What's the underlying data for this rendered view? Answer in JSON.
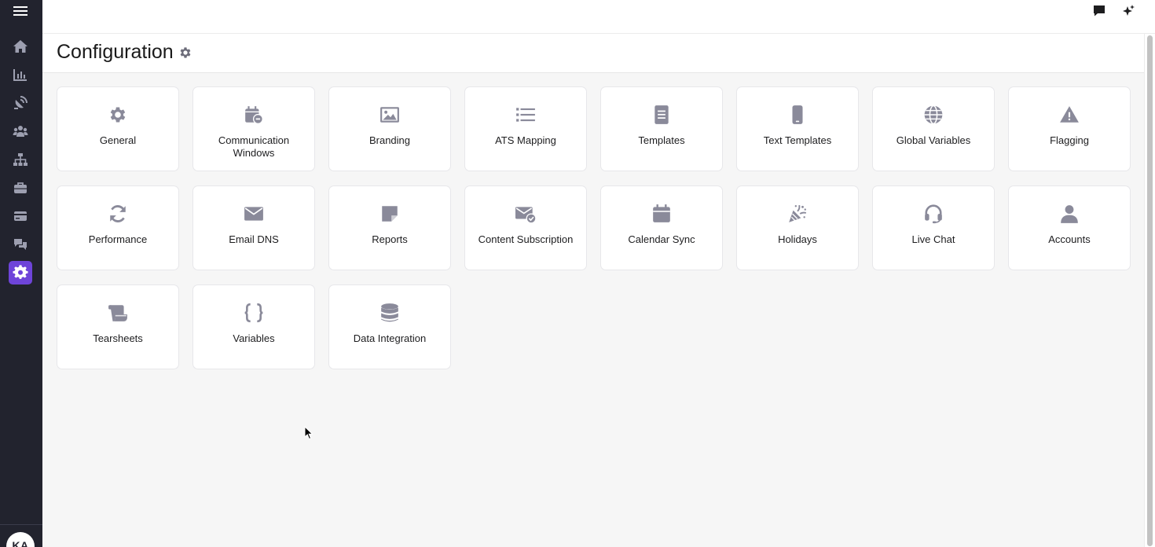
{
  "page": {
    "title": "Configuration"
  },
  "user": {
    "initials": "KA"
  },
  "colors": {
    "sidebar_bg": "#22232e",
    "active_accent": "#6e44d9",
    "icon_color": "#8a8a9a"
  },
  "sidebar": {
    "items": [
      {
        "name": "home",
        "icon": "home-icon"
      },
      {
        "name": "analytics",
        "icon": "bar-chart-icon"
      },
      {
        "name": "sourcing",
        "icon": "satellite-dish-icon"
      },
      {
        "name": "candidates",
        "icon": "people-group-icon"
      },
      {
        "name": "org",
        "icon": "sitemap-icon"
      },
      {
        "name": "jobs",
        "icon": "briefcase-icon"
      },
      {
        "name": "billing",
        "icon": "credit-card-icon"
      },
      {
        "name": "messages",
        "icon": "chat-bubbles-icon"
      },
      {
        "name": "configuration",
        "icon": "gear-icon",
        "active": true
      }
    ]
  },
  "cards": [
    {
      "id": "general",
      "label": "General",
      "icon": "gear-icon"
    },
    {
      "id": "communication-windows",
      "label": "Communication Windows",
      "icon": "calendar-clock-icon"
    },
    {
      "id": "branding",
      "label": "Branding",
      "icon": "image-icon"
    },
    {
      "id": "ats-mapping",
      "label": "ATS Mapping",
      "icon": "list-icon"
    },
    {
      "id": "templates",
      "label": "Templates",
      "icon": "document-icon"
    },
    {
      "id": "text-templates",
      "label": "Text Templates",
      "icon": "mobile-phone-icon"
    },
    {
      "id": "global-variables",
      "label": "Global Variables",
      "icon": "globe-icon"
    },
    {
      "id": "flagging",
      "label": "Flagging",
      "icon": "warning-triangle-icon"
    },
    {
      "id": "performance",
      "label": "Performance",
      "icon": "refresh-icon"
    },
    {
      "id": "email-dns",
      "label": "Email DNS",
      "icon": "envelope-icon"
    },
    {
      "id": "reports",
      "label": "Reports",
      "icon": "sticky-note-icon"
    },
    {
      "id": "content-subscription",
      "label": "Content Subscription",
      "icon": "envelope-check-icon"
    },
    {
      "id": "calendar-sync",
      "label": "Calendar Sync",
      "icon": "calendar-icon"
    },
    {
      "id": "holidays",
      "label": "Holidays",
      "icon": "party-popper-icon"
    },
    {
      "id": "live-chat",
      "label": "Live Chat",
      "icon": "headset-icon"
    },
    {
      "id": "accounts",
      "label": "Accounts",
      "icon": "user-icon"
    },
    {
      "id": "tearsheets",
      "label": "Tearsheets",
      "icon": "scroll-icon"
    },
    {
      "id": "variables",
      "label": "Variables",
      "icon": "curly-braces-icon"
    },
    {
      "id": "data-integration",
      "label": "Data Integration",
      "icon": "database-icon"
    }
  ]
}
